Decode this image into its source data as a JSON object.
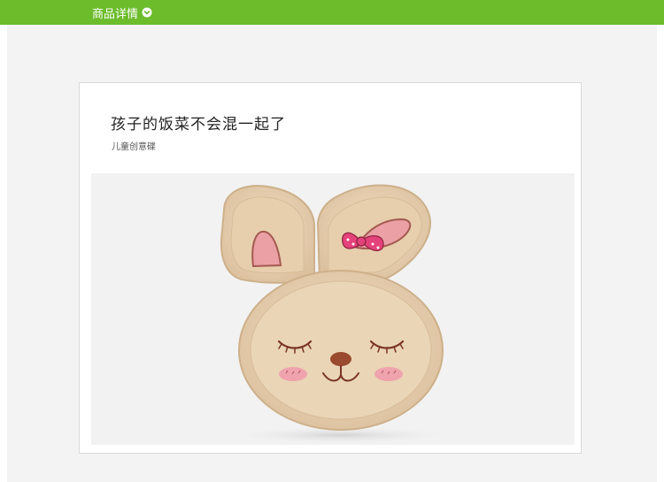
{
  "header": {
    "tab_label": "商品详情",
    "tab_icon": "chevron-down-circle-icon",
    "bar_color": "#6cbc2b"
  },
  "product": {
    "headline": "孩子的饭菜不会混一起了",
    "subheadline": "儿童创意碟",
    "image_subject": "rabbit-shaped kids dinner plate"
  }
}
